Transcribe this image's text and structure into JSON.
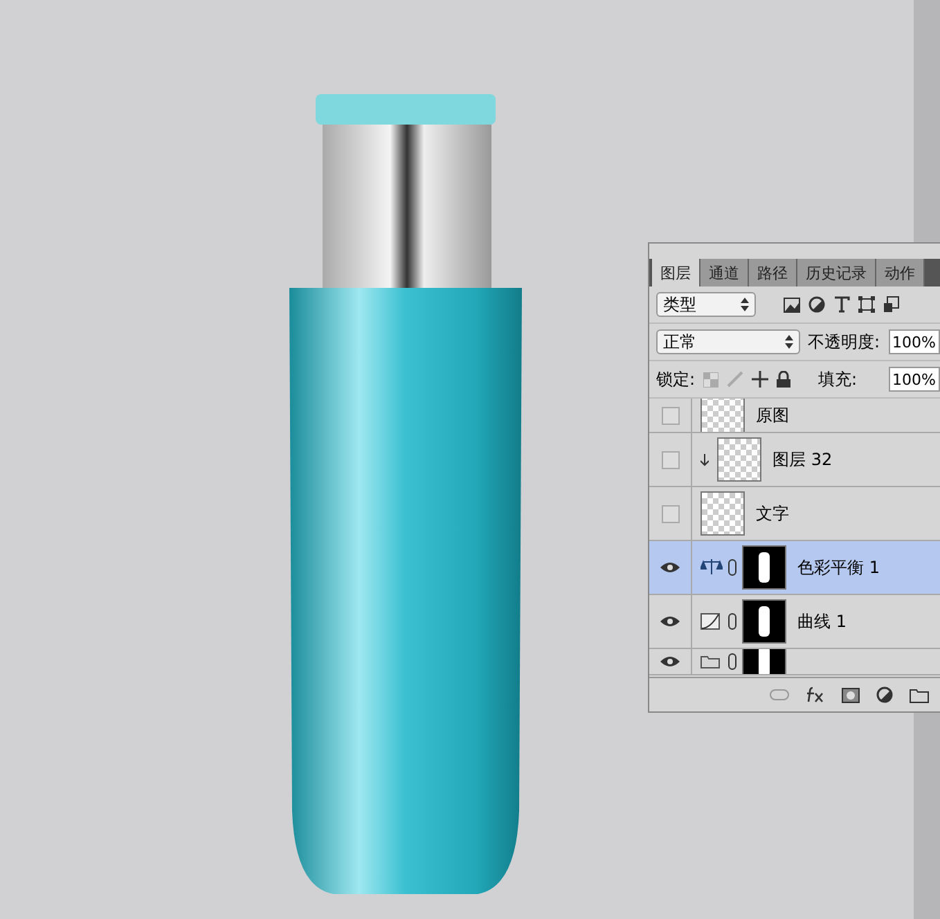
{
  "layers_panel": {
    "tabs": [
      {
        "label": "图层",
        "selected": true
      },
      {
        "label": "通道",
        "selected": false
      },
      {
        "label": "路径",
        "selected": false
      },
      {
        "label": "历史记录",
        "selected": false
      },
      {
        "label": "动作",
        "selected": false
      }
    ],
    "filter": {
      "value": "类型"
    },
    "blend_mode": {
      "value": "正常"
    },
    "opacity": {
      "label": "不透明度:",
      "value": "100%"
    },
    "lock": {
      "label": "锁定:"
    },
    "fill": {
      "label": "填充:",
      "value": "100%"
    },
    "layers": [
      {
        "name": "原图",
        "kind": "smart",
        "visible": false,
        "selected": false,
        "clipped": false
      },
      {
        "name": "图层 32",
        "kind": "smart",
        "visible": false,
        "selected": false,
        "clipped": true
      },
      {
        "name": "文字",
        "kind": "smart",
        "visible": false,
        "selected": false,
        "clipped": false
      },
      {
        "name": "色彩平衡 1",
        "kind": "balance",
        "visible": true,
        "selected": true,
        "clipped": false
      },
      {
        "name": "曲线 1",
        "kind": "curves",
        "visible": true,
        "selected": false,
        "clipped": false
      },
      {
        "kind": "group",
        "visible": true,
        "selected": false,
        "clipped": false
      }
    ]
  }
}
